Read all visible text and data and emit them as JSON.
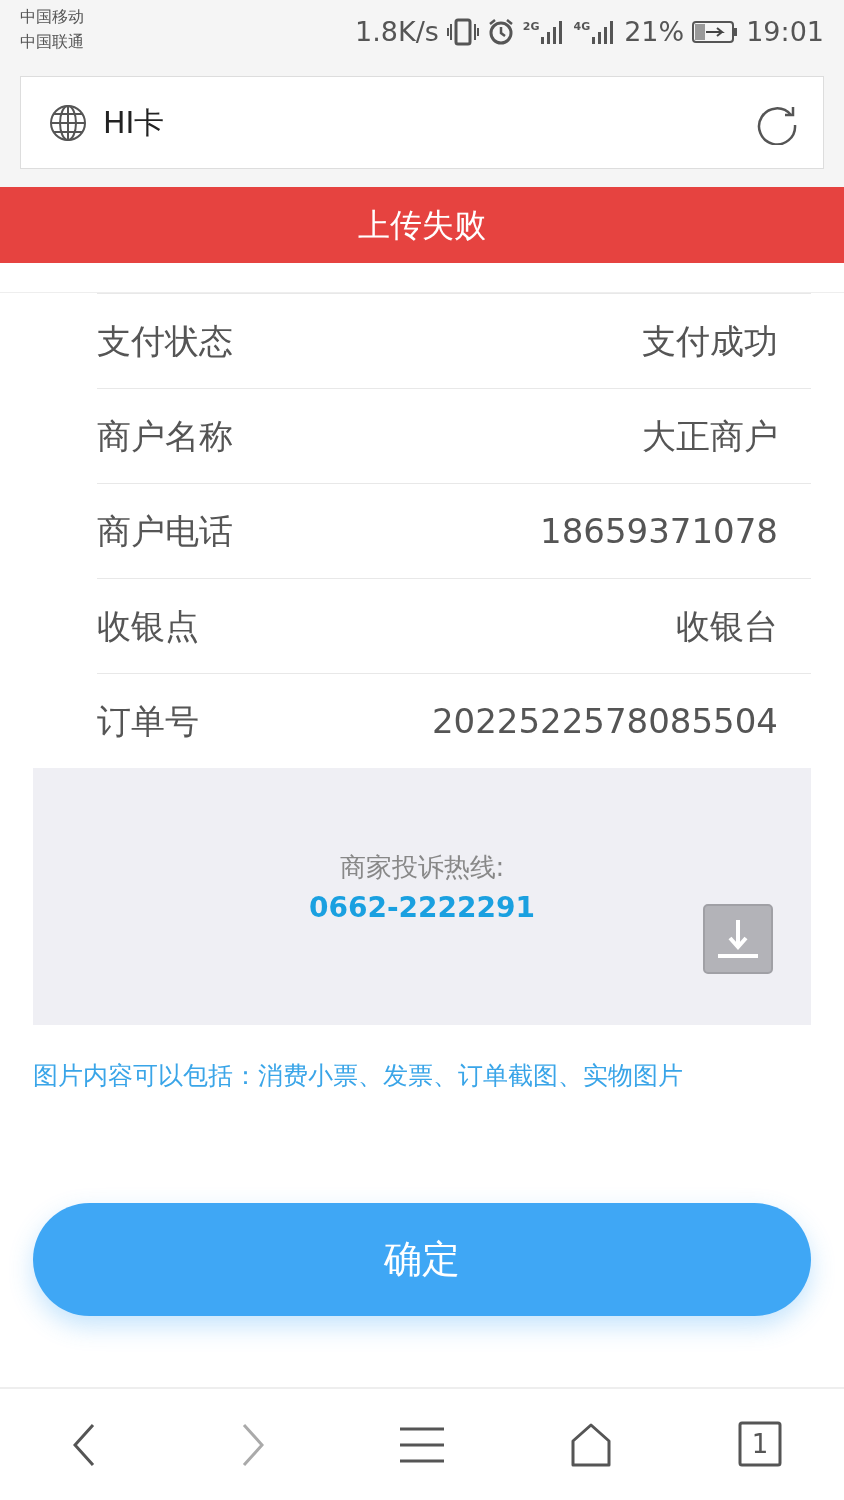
{
  "status_bar": {
    "carriers": [
      "中国移动",
      "中国联通"
    ],
    "speed": "1.8K/s",
    "sim1_network": "2G",
    "sim2_network": "4G",
    "battery": "21%",
    "time": "19:01"
  },
  "address_bar": {
    "title": "HI卡"
  },
  "banner": {
    "text": "上传失败"
  },
  "details": [
    {
      "label": "支付状态",
      "value": "支付成功"
    },
    {
      "label": "商户名称",
      "value": "大正商户"
    },
    {
      "label": "商户电话",
      "value": "18659371078"
    },
    {
      "label": "收银点",
      "value": "收银台"
    },
    {
      "label": "订单号",
      "value": "2022522578085504"
    }
  ],
  "complaint": {
    "label": "商家投诉热线:",
    "phone": "0662-2222291"
  },
  "hint": "图片内容可以包括：消费小票、发票、订单截图、实物图片",
  "confirm_button": "确定",
  "bottom_nav": [
    {
      "kind": "back",
      "disabled": false
    },
    {
      "kind": "forward",
      "disabled": true
    },
    {
      "kind": "menu",
      "disabled": false
    },
    {
      "kind": "home",
      "disabled": false
    },
    {
      "kind": "tabs",
      "count": "1",
      "disabled": false
    }
  ]
}
